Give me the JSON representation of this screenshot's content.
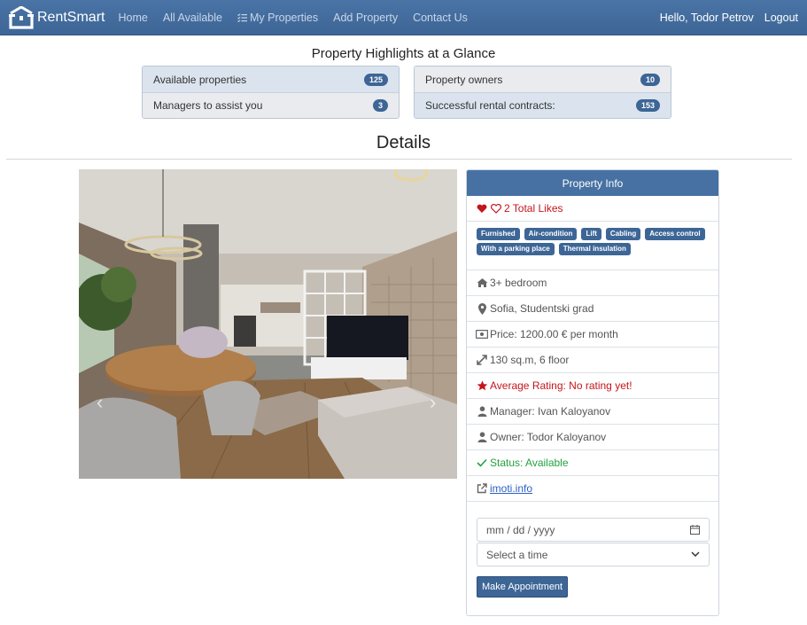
{
  "nav": {
    "brand": "RentSmart",
    "links": [
      "Home",
      "All Available",
      "My Properties",
      "Add Property",
      "Contact Us"
    ],
    "greeting": "Hello, Todor Petrov",
    "logout": "Logout"
  },
  "highlights": {
    "title": "Property Highlights at a Glance",
    "left": [
      {
        "label": "Available properties",
        "count": "125"
      },
      {
        "label": "Managers to assist you",
        "count": "3"
      }
    ],
    "right": [
      {
        "label": "Property owners",
        "count": "10"
      },
      {
        "label": "Successful rental contracts:",
        "count": "153"
      }
    ]
  },
  "details_title": "Details",
  "info": {
    "header": "Property Info",
    "likes": "2 Total Likes",
    "tags": [
      "Furnished",
      "Air-condition",
      "Lift",
      "Cabling",
      "Access control",
      "With a parking place",
      "Thermal insulation"
    ],
    "bedrooms": "3+ bedroom",
    "location": "Sofia, Studentski grad",
    "price": "Price: 1200.00 € per month",
    "size": "130 sq.m, 6 floor",
    "rating": "Average Rating: No rating yet!",
    "manager": "Manager: Ivan Kaloyanov",
    "owner": "Owner: Todor Kaloyanov",
    "status": "Status: Available",
    "source": "imoti.info"
  },
  "form": {
    "date_placeholder": "mm / dd / yyyy",
    "time_placeholder": "Select a time",
    "submit": "Make Appointment"
  },
  "colors": {
    "navbar": "#4a74a6",
    "accent": "#3d6696",
    "danger": "#c4151c",
    "success": "#22a340"
  }
}
